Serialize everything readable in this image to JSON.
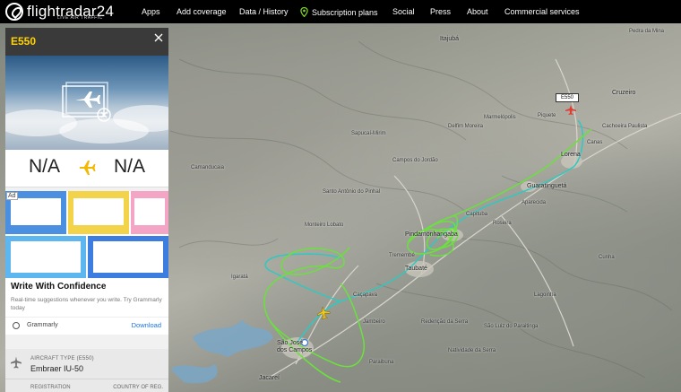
{
  "nav": {
    "brand": "flightradar24",
    "tagline": "LIVE AIR TRAFFIC",
    "items": [
      {
        "label": "Apps"
      },
      {
        "label": "Add coverage"
      },
      {
        "label": "Data / History"
      },
      {
        "label": "Subscription plans"
      },
      {
        "label": "Social"
      },
      {
        "label": "Press"
      },
      {
        "label": "About"
      },
      {
        "label": "Commercial services"
      }
    ]
  },
  "panel": {
    "callsign": "E550",
    "route": {
      "from": "N/A",
      "to": "N/A"
    },
    "ad": {
      "badge": "Ad",
      "title": "Write With Confidence",
      "description": "Real-time suggestions whenever you write. Try Grammarly today",
      "brand": "Grammarly",
      "cta": "Download"
    },
    "info": {
      "aircraft_type_label": "AIRCRAFT TYPE",
      "aircraft_type_code": "(E550)",
      "aircraft_type_value": "Embraer IU-50",
      "registration_label": "REGISTRATION",
      "country_label": "COUNTRY OF REG."
    }
  },
  "map": {
    "callsign_tag": "E550",
    "labels": [
      {
        "text": "Itajubá"
      },
      {
        "text": "Cruzeiro"
      },
      {
        "text": "Pedra da Mina"
      },
      {
        "text": "Lorena"
      },
      {
        "text": "Cachoeira Paulista"
      },
      {
        "text": "Guaratinguetá"
      },
      {
        "text": "Pindamonhangaba"
      },
      {
        "text": "Taubaté"
      },
      {
        "text": "São José dos Campos"
      },
      {
        "text": "Jacareí"
      },
      {
        "text": "Campos do Jordão"
      },
      {
        "text": "Cunha"
      },
      {
        "text": "Canas"
      },
      {
        "text": "Roseira"
      },
      {
        "text": "Aparecida"
      },
      {
        "text": "Lagoinha"
      },
      {
        "text": "Paraibuna"
      },
      {
        "text": "Caçapava"
      },
      {
        "text": "Tremembé"
      },
      {
        "text": "Natividade da Serra"
      },
      {
        "text": "Santo Antônio do Pinhal"
      },
      {
        "text": "Sapucaí-Mirim"
      },
      {
        "text": "Delfim Moreira"
      },
      {
        "text": "Marmelópolis"
      },
      {
        "text": "Piquete"
      },
      {
        "text": "Camanducaia"
      },
      {
        "text": "Monteiro Lobato"
      },
      {
        "text": "Igaratá"
      },
      {
        "text": "Capituba"
      },
      {
        "text": "Jambeiro"
      },
      {
        "text": "Redenção da Serra"
      },
      {
        "text": "São Luiz do Paraitinga"
      }
    ]
  }
}
